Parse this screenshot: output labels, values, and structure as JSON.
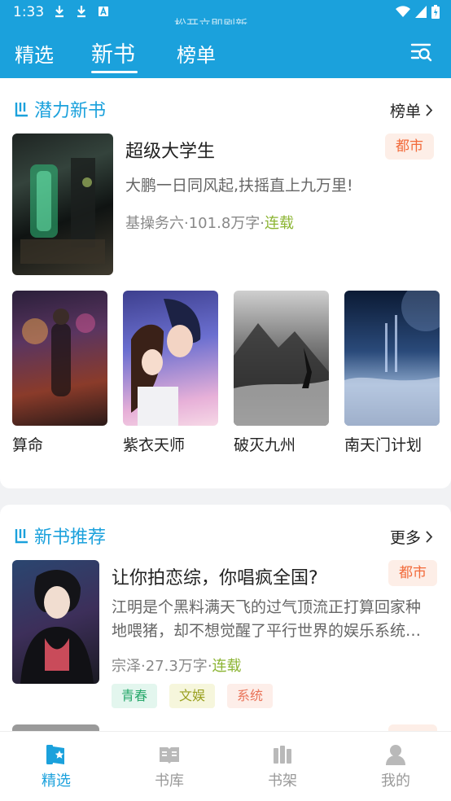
{
  "status_bar": {
    "time": "1:33",
    "scroll_text": "松开立即刷新"
  },
  "top_tabs": [
    {
      "label": "精选",
      "active": false
    },
    {
      "label": "新书",
      "active": true
    },
    {
      "label": "榜单",
      "active": false
    }
  ],
  "colors": {
    "brand": "#1ba1dc",
    "tag_orange": "#f26a3a",
    "status_green": "#8cb534"
  },
  "potential": {
    "title": "潜力新书",
    "link": "榜单",
    "featured": {
      "title": "超级大学生",
      "category": "都市",
      "desc": "大鹏一日同风起,扶摇直上九万里!",
      "author": "基操务六",
      "words": "101.8万字",
      "status": "连载"
    },
    "books": [
      {
        "title": "算命"
      },
      {
        "title": "紫衣天师"
      },
      {
        "title": "破灭九州"
      },
      {
        "title": "南天门计划"
      }
    ]
  },
  "recommend": {
    "title": "新书推荐",
    "link": "更多",
    "book": {
      "title": "让你拍恋综，你唱疯全国?",
      "category": "都市",
      "desc": "江明是个黑料满天飞的过气顶流正打算回家种地喂猪，却不想觉醒了平行世界的娱乐系统…",
      "author": "宗泽",
      "words": "27.3万字",
      "status": "连载",
      "tags": [
        "青春",
        "文娱",
        "系统"
      ]
    }
  },
  "bottom_nav": [
    {
      "label": "精选",
      "icon": "star-book-icon",
      "active": true
    },
    {
      "label": "书库",
      "icon": "library-icon",
      "active": false
    },
    {
      "label": "书架",
      "icon": "bookshelf-icon",
      "active": false
    },
    {
      "label": "我的",
      "icon": "profile-icon",
      "active": false
    }
  ]
}
